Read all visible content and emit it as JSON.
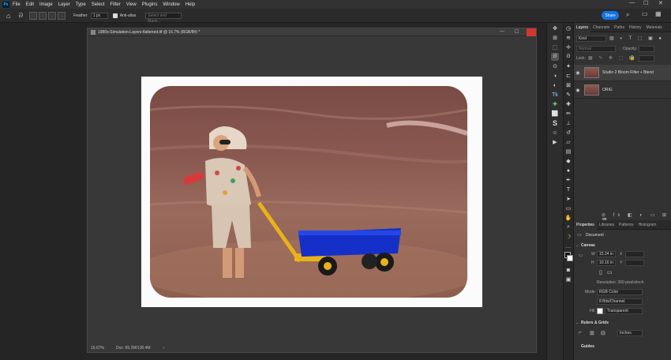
{
  "menu": {
    "app_icon": "Ps",
    "items": [
      "File",
      "Edit",
      "Image",
      "Layer",
      "Type",
      "Select",
      "Filter",
      "View",
      "Plugins",
      "Window",
      "Help"
    ]
  },
  "options": {
    "feather_label": "Feather:",
    "feather_value": "1 px",
    "antialias_label": "Anti-alias",
    "select_mask": "Select and Mask..."
  },
  "share_label": "Share",
  "document": {
    "title": "1980s-Simulation-Layers-flattened.tif @ 16.7% (RGB/8#) *",
    "zoom": "16.67%",
    "doc_size": "Doc: 65.2M/130.4M"
  },
  "layers_panel": {
    "tabs": [
      "Layers",
      "Channels",
      "Paths",
      "History",
      "Materials"
    ],
    "kind_label": "Kind",
    "blend_mode": "Normal",
    "opacity_label": "Opacity:",
    "lock_label": "Lock:",
    "fill_label": "Fill:",
    "layers": [
      {
        "name": "Studio 2 Bloom Filter + Blend"
      },
      {
        "name": "ORIG"
      }
    ]
  },
  "properties_panel": {
    "tabs": [
      "Properties",
      "Libraries",
      "Patterns",
      "Histogram"
    ],
    "document_label": "Document",
    "canvas_header": "Canvas",
    "w_label": "W",
    "w_value": "15.24 in",
    "h_label": "H",
    "h_value": "10.16 in",
    "x_label": "X",
    "y_label": "Y",
    "resolution": "Resolution: 300 pixels/inch",
    "mode_label": "Mode",
    "mode_value": "RGB Color",
    "bits_value": "8 Bits/Channel",
    "fill_label": "Fill",
    "fill_value": "Transparent",
    "rulers_header": "Rulers & Grids",
    "units_value": "Inches",
    "guides_header": "Guides"
  },
  "colors": {
    "accent": "#1473e6",
    "close": "#d3362f"
  }
}
